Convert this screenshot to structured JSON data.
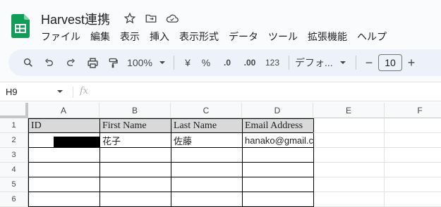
{
  "doc": {
    "title": "Harvest連携"
  },
  "menu": [
    "ファイル",
    "編集",
    "表示",
    "挿入",
    "表示形式",
    "データ",
    "ツール",
    "拡張機能",
    "ヘルプ"
  ],
  "toolbar": {
    "zoom": "100%",
    "currency": "¥",
    "percent": "%",
    "dec_decrease": ".0",
    "dec_increase": ".00",
    "number_format": "123",
    "font": "デフォ...",
    "font_size": "10",
    "minus": "−",
    "plus": "+"
  },
  "formula_bar": {
    "name_box": "H9",
    "fx": "fx"
  },
  "columns": [
    "A",
    "B",
    "C",
    "D",
    "E",
    "F"
  ],
  "rows": [
    "1",
    "2",
    "3",
    "4",
    "5",
    "6"
  ],
  "table": {
    "headers": [
      "ID",
      "First Name",
      "Last Name",
      "Email Address"
    ],
    "row2": {
      "id": "",
      "first": "花子",
      "last": "佐藤",
      "email": "hanako@gmail.com"
    }
  },
  "colors": {
    "logo": "#0f9d58",
    "header_fill": "#d9d9d9"
  }
}
